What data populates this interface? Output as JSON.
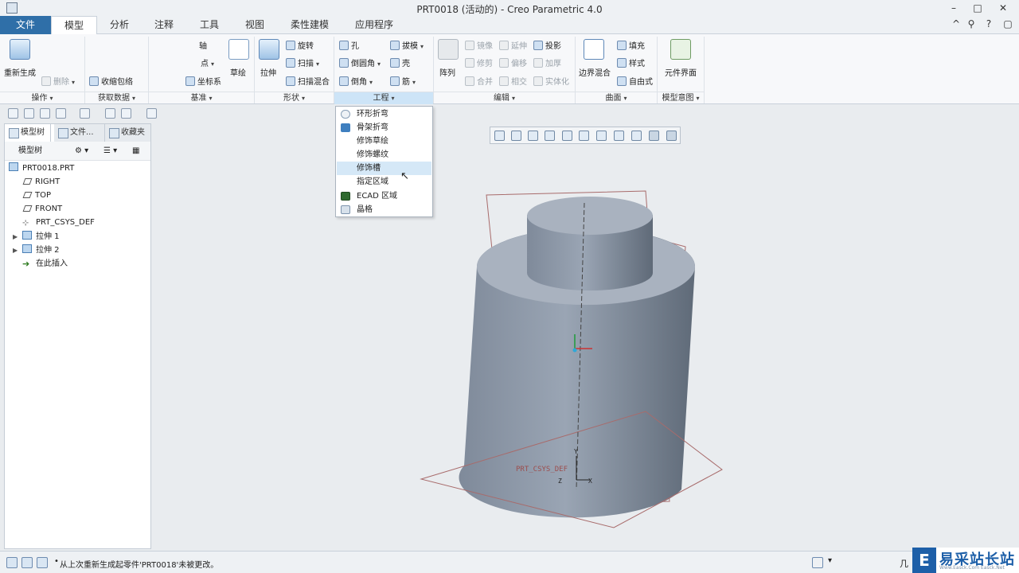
{
  "window": {
    "title": "PRT0018 (活动的) - Creo Parametric 4.0",
    "minimize": "–",
    "maximize": "□",
    "close": "✕"
  },
  "tabs": [
    {
      "label": "文件"
    },
    {
      "label": "模型"
    },
    {
      "label": "分析"
    },
    {
      "label": "注释"
    },
    {
      "label": "工具"
    },
    {
      "label": "视图"
    },
    {
      "label": "柔性建模"
    },
    {
      "label": "应用程序"
    }
  ],
  "tabbar_right": {
    "collapse": "^",
    "search": "⚲",
    "help": "?"
  },
  "ribbon": {
    "operations": {
      "regenerate": "重新生成",
      "delete": "删除",
      "group_label": "操作"
    },
    "get_data": {
      "shrinkwrap": "收缩包络",
      "group_label": "获取数据"
    },
    "datum": {
      "axis": "轴",
      "point": "点",
      "csys": "坐标系",
      "sketch": "草绘",
      "group_label": "基准"
    },
    "shapes": {
      "extrude": "拉伸",
      "revolve": "旋转",
      "sweep": "扫描",
      "swept_blend": "扫描混合",
      "group_label": "形状"
    },
    "engineering": {
      "hole": "孔",
      "round": "倒圆角",
      "chamfer": "倒角",
      "draft": "拔模",
      "shell": "壳",
      "rib": "筋",
      "group_label": "工程"
    },
    "editing": {
      "pattern": "阵列",
      "mirror": "镜像",
      "extend": "延伸",
      "project": "投影",
      "trim": "修剪",
      "offset": "偏移",
      "thicken": "加厚",
      "merge": "合并",
      "intersect": "相交",
      "solidify": "实体化",
      "group_label": "编辑"
    },
    "surfaces": {
      "boundary_blend": "边界混合",
      "fill": "填充",
      "style": "样式",
      "freestyle": "自由式",
      "group_label": "曲面"
    },
    "model_intent": {
      "component_interface": "元件界面",
      "group_label": "模型意图"
    }
  },
  "dropdown": {
    "items": [
      {
        "label": "环形折弯",
        "icon": "toroidal-bend-icon"
      },
      {
        "label": "骨架折弯",
        "icon": "spinal-bend-icon"
      },
      {
        "label": "修饰草绘",
        "icon": "cosmetic-sketch-icon"
      },
      {
        "label": "修饰螺纹",
        "icon": "cosmetic-thread-icon"
      },
      {
        "label": "修饰槽",
        "icon": "cosmetic-groove-icon"
      },
      {
        "label": "指定区域",
        "icon": "designate-area-icon"
      },
      {
        "label": "ECAD 区域",
        "icon": "ecad-area-icon"
      },
      {
        "label": "晶格",
        "icon": "lattice-icon"
      }
    ]
  },
  "left_panel": {
    "tabs": [
      {
        "label": "模型树"
      },
      {
        "label": "文件..."
      },
      {
        "label": "收藏夹"
      }
    ],
    "tree_header": "模型树",
    "tree": [
      {
        "label": "PRT0018.PRT",
        "icon": "part-icon"
      },
      {
        "label": "RIGHT",
        "icon": "datum-plane-icon"
      },
      {
        "label": "TOP",
        "icon": "datum-plane-icon"
      },
      {
        "label": "FRONT",
        "icon": "datum-plane-icon"
      },
      {
        "label": "PRT_CSYS_DEF",
        "icon": "csys-icon"
      },
      {
        "label": "拉伸 1",
        "icon": "extrude-icon"
      },
      {
        "label": "拉伸 2",
        "icon": "extrude-icon"
      },
      {
        "label": "在此插入",
        "icon": "insert-arrow-icon"
      }
    ]
  },
  "viewport": {
    "csys_label": "PRT_CSYS_DEF",
    "axis_x": "X",
    "axis_y": "Y",
    "axis_z": "Z",
    "model_color": "#8f9aaa"
  },
  "status": {
    "message": "从上次重新生成起零件'PRT0018'未被更改。",
    "right_text": "几"
  },
  "watermark": {
    "text": "易采站长站",
    "sub": "Www.Easck.Com Easck.Net"
  }
}
